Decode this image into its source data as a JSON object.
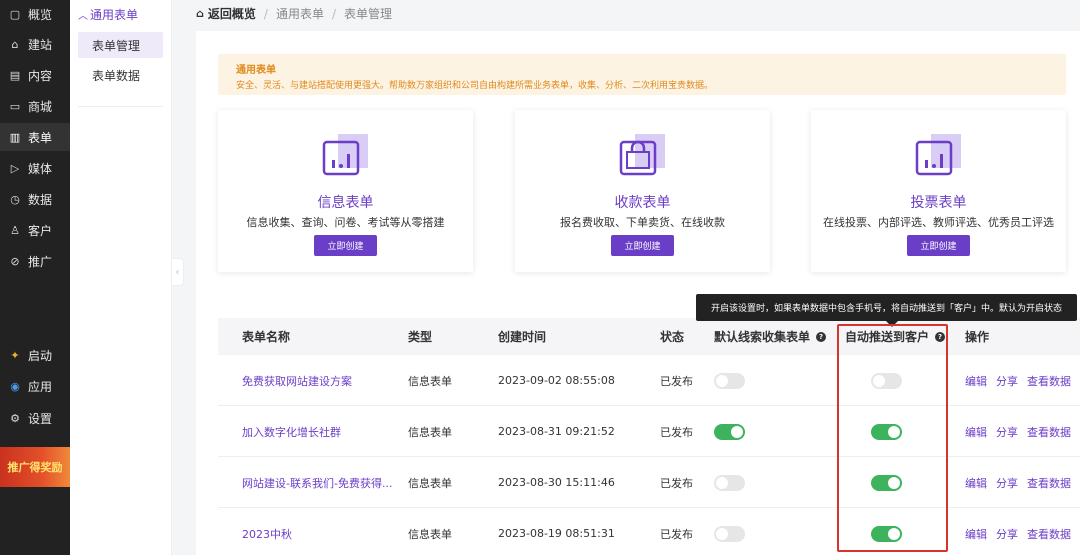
{
  "nav": {
    "items": [
      {
        "label": "概览",
        "icon": "dashboard-icon",
        "glyph": "▢"
      },
      {
        "label": "建站",
        "icon": "home-icon",
        "glyph": "⌂"
      },
      {
        "label": "内容",
        "icon": "document-icon",
        "glyph": "▤"
      },
      {
        "label": "商城",
        "icon": "cart-icon",
        "glyph": "▭"
      },
      {
        "label": "表单",
        "icon": "form-icon",
        "glyph": "▥"
      },
      {
        "label": "媒体",
        "icon": "media-icon",
        "glyph": "▷"
      },
      {
        "label": "数据",
        "icon": "clock-icon",
        "glyph": "◷"
      },
      {
        "label": "客户",
        "icon": "user-icon",
        "glyph": "♙"
      },
      {
        "label": "推广",
        "icon": "link-icon",
        "glyph": "⊘"
      }
    ],
    "bottom_items": [
      {
        "label": "启动",
        "icon": "launch-icon",
        "glyph": "✦"
      },
      {
        "label": "应用",
        "icon": "apps-icon",
        "glyph": "◉"
      },
      {
        "label": "设置",
        "icon": "gear-icon",
        "glyph": "⚙"
      }
    ],
    "promo_label": "推广得奖励"
  },
  "subnav": {
    "group_label": "通用表单",
    "items": [
      {
        "label": "表单管理"
      },
      {
        "label": "表单数据"
      }
    ]
  },
  "breadcrumb": {
    "home": "返回概览",
    "items": [
      "通用表单",
      "表单管理"
    ]
  },
  "notice": {
    "title": "通用表单",
    "text": "安全、灵活、与建站搭配使用更强大。帮助数万家组织和公司自由构建所需业务表单，收集、分析、二次利用宝贵数据。"
  },
  "cards": [
    {
      "title": "信息表单",
      "desc": "信息收集、查询、问卷、考试等从零搭建",
      "button": "立即创建",
      "icon": "chart-icon"
    },
    {
      "title": "收款表单",
      "desc": "报名费收取、下单卖货、在线收款",
      "button": "立即创建",
      "icon": "bag-icon"
    },
    {
      "title": "投票表单",
      "desc": "在线投票、内部评选、教师评选、优秀员工评选",
      "button": "立即创建",
      "icon": "chart-icon"
    }
  ],
  "tooltip": "开启该设置时，如果表单数据中包含手机号，将自动推送到「客户」中。默认为开启状态",
  "table": {
    "headers": {
      "name": "表单名称",
      "type": "类型",
      "created": "创建时间",
      "status": "状态",
      "lead_collect": "默认线索收集表单",
      "auto_push": "自动推送到客户",
      "actions": "操作"
    },
    "rows": [
      {
        "name": "免费获取网站建设方案",
        "type": "信息表单",
        "created": "2023-09-02 08:55:08",
        "status": "已发布",
        "lead_collect": false,
        "auto_push": false
      },
      {
        "name": "加入数字化增长社群",
        "type": "信息表单",
        "created": "2023-08-31 09:21:52",
        "status": "已发布",
        "lead_collect": true,
        "auto_push": true
      },
      {
        "name": "网站建设-联系我们-免费获得...",
        "type": "信息表单",
        "created": "2023-08-30 15:11:46",
        "status": "已发布",
        "lead_collect": false,
        "auto_push": true
      },
      {
        "name": "2023中秋",
        "type": "信息表单",
        "created": "2023-08-19 08:51:31",
        "status": "已发布",
        "lead_collect": false,
        "auto_push": true
      }
    ],
    "action_labels": {
      "edit": "编辑",
      "share": "分享",
      "view": "查看数据"
    }
  },
  "colors": {
    "accent": "#6b3ec7",
    "toggle_on": "#3cb35c",
    "highlight": "#d9342b",
    "notice_text": "#e08a1e"
  }
}
